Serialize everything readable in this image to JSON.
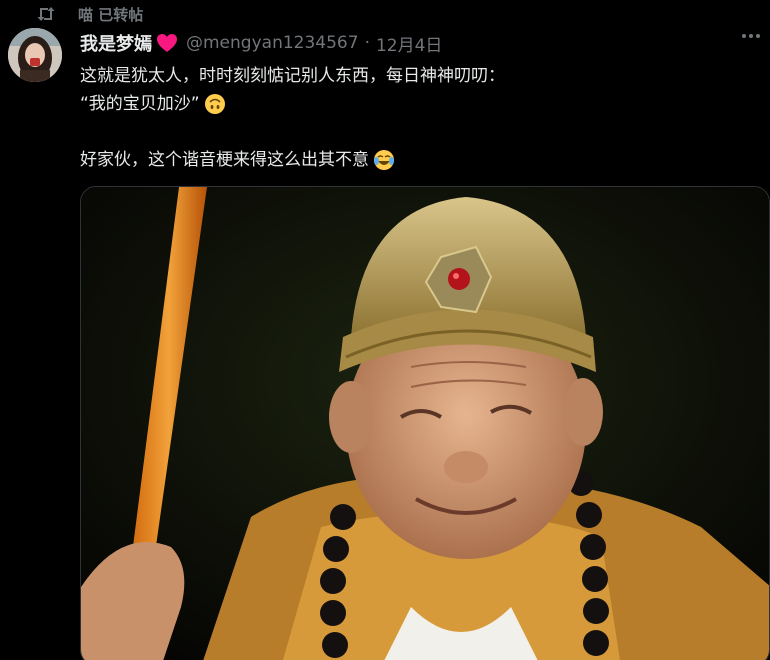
{
  "retweet": {
    "label": "喵 已转帖",
    "icon": "retweet-icon"
  },
  "author": {
    "display_name": "我是梦嫣",
    "badge": "heart-icon",
    "handle": "@mengyan1234567",
    "separator": "·",
    "date": "12月4日"
  },
  "tweet": {
    "line1": "这就是犹太人，时时刻刻惦记别人东西，每日神神叨叨：",
    "line2": "“我的宝贝加沙”",
    "line3": "好家伙，这个谐音梗来得这么出其不意"
  },
  "colors": {
    "background": "#000000",
    "text": "#e7e9ea",
    "muted": "#71767b",
    "heart": "#f91880",
    "border": "#2f3336"
  }
}
